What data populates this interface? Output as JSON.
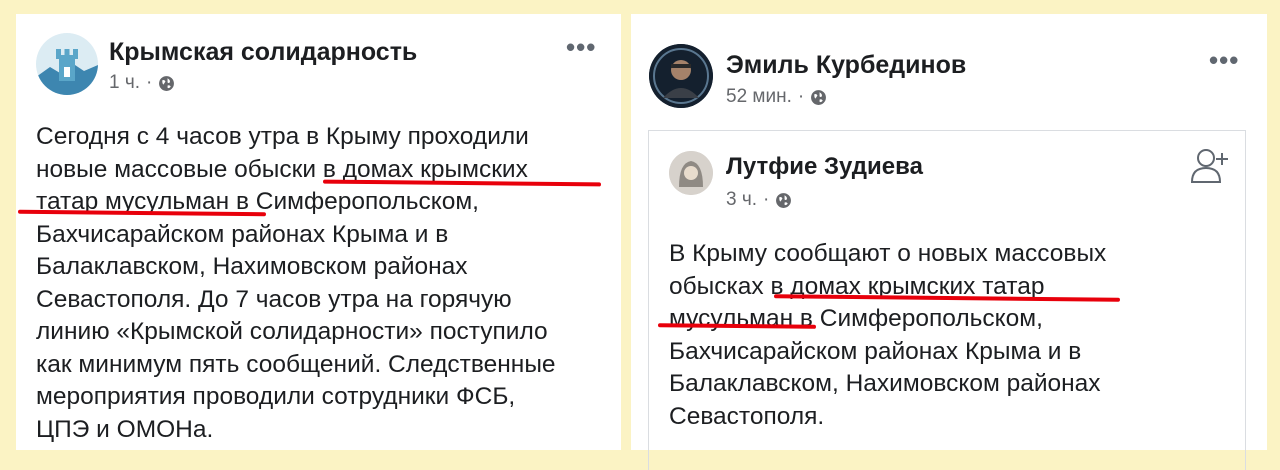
{
  "left_post": {
    "author": "Крымская солидарность",
    "time": "1 ч.",
    "separator": "·",
    "more_icon": "more-horizontal-icon",
    "audience_icon": "globe-icon",
    "text": "Сегодня с 4 часов утра в Крыму проходили\nновые массовые обыски в домах крымских\nтатар мусульман в Симферопольском,\nБахчисарайском районах Крыма и в\nБалаклавском, Нахимовском районах\nСевастополя. До 7 часов утра на горячую\nлинию «Крымской солидарности» поступило\nкак минимум пять сообщений. Следственные\nмероприятия проводили сотрудники ФСБ,\nЦПЭ и ОМОНа."
  },
  "right_post": {
    "author": "Эмиль Курбединов",
    "time": "52 мин.",
    "separator": "·",
    "more_icon": "more-horizontal-icon",
    "audience_icon": "globe-icon",
    "shared": {
      "author": "Лутфие Зудиева",
      "time": "3 ч.",
      "separator": "·",
      "audience_icon": "globe-icon",
      "add_friend_icon": "add-friend-icon",
      "text": "В Крыму сообщают о новых массовых\nобысках в домах крымских татар\nмусульман в Симферопольском,\nБахчисарайском районах Крыма и в\nБалаклавском, Нахимовском районах\nСевастополя."
    }
  },
  "colors": {
    "background": "#fbf3c4",
    "highlight_underline": "#e8000b",
    "meta_text": "#65676b"
  }
}
